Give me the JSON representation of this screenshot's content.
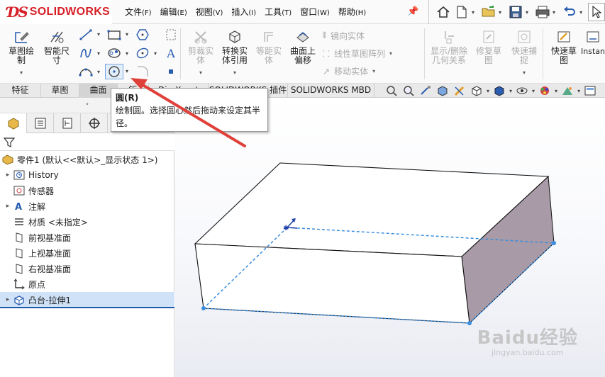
{
  "app": {
    "logo_text": "SOLIDWORKS",
    "brand_color": "#d61f26"
  },
  "menu": [
    {
      "label": "文件",
      "key": "(F)"
    },
    {
      "label": "编辑",
      "key": "(E)"
    },
    {
      "label": "视图",
      "key": "(V)"
    },
    {
      "label": "插入",
      "key": "(I)"
    },
    {
      "label": "工具",
      "key": "(T)"
    },
    {
      "label": "窗口",
      "key": "(W)"
    },
    {
      "label": "帮助",
      "key": "(H)"
    }
  ],
  "commands": {
    "sketch": "草图绘制",
    "smart_dim": "智能尺寸",
    "trim": "剪裁实体",
    "convert": "转换实体引用",
    "offset": "等距实体",
    "offset_surface": "曲面上偏移",
    "mirror": "镜向实体",
    "linear_pattern": "线性草图阵列",
    "move": "移动实体",
    "display_relations": "显示/删除几何关系",
    "repair": "修复草图",
    "rapid_snaps": "快速捕捉",
    "rapid_sketch": "快速草图",
    "instant": "Instan"
  },
  "tabs": [
    "特征",
    "草图",
    "曲面",
    "钣",
    "DimXpert",
    "SOLIDWORKS 插件",
    "SOLIDWORKS MBD"
  ],
  "tooltip": {
    "title": "圆(R)",
    "body": "绘制圆。选择圆心然后拖动来设定其半径。"
  },
  "tree": {
    "root": "零件1 (默认<<默认>_显示状态 1>)",
    "items": [
      {
        "label": "History",
        "expand": true,
        "icon": "history-icon"
      },
      {
        "label": "传感器",
        "expand": false,
        "icon": "sensor-icon"
      },
      {
        "label": "注解",
        "expand": true,
        "icon": "annotation-icon"
      },
      {
        "label": "材质 <未指定>",
        "expand": false,
        "icon": "material-icon"
      },
      {
        "label": "前视基准面",
        "expand": false,
        "icon": "plane-icon"
      },
      {
        "label": "上视基准面",
        "expand": false,
        "icon": "plane-icon"
      },
      {
        "label": "右视基准面",
        "expand": false,
        "icon": "plane-icon"
      },
      {
        "label": "原点",
        "expand": false,
        "icon": "origin-icon"
      },
      {
        "label": "凸台-拉伸1",
        "expand": true,
        "icon": "extrude-icon",
        "selected": true
      }
    ]
  },
  "watermark": {
    "main": "Baidu经验",
    "sub": "jingyan.baidu.com"
  },
  "colors": {
    "accent": "#1f5aa8",
    "arrow": "#e0403a",
    "box_side": "#a89aa6",
    "dash": "#3a8ee0"
  }
}
